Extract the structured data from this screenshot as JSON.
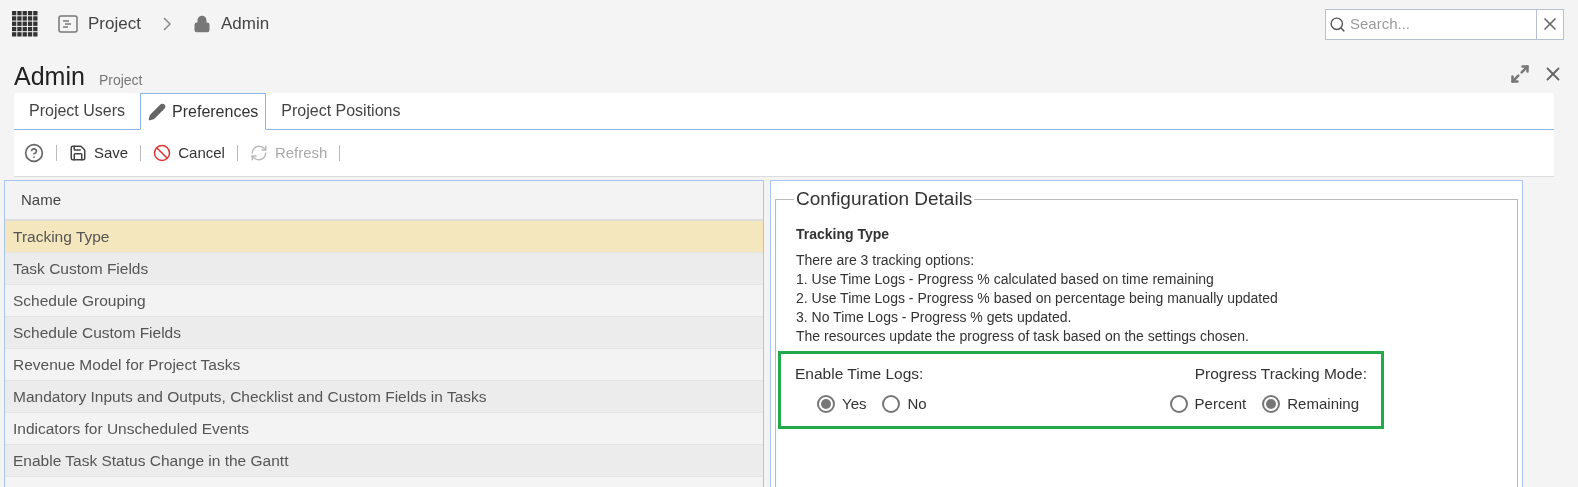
{
  "breadcrumb": [
    {
      "kind": "project",
      "label": "Project"
    },
    {
      "kind": "lock",
      "label": "Admin"
    }
  ],
  "search": {
    "placeholder": "Search..."
  },
  "page": {
    "title": "Admin",
    "subtitle": "Project"
  },
  "tabs": [
    {
      "label": "Project Users",
      "selected": false,
      "kind": "plain"
    },
    {
      "label": "Preferences",
      "selected": true,
      "kind": "pencil"
    },
    {
      "label": "Project Positions",
      "selected": false,
      "kind": "plain"
    }
  ],
  "toolbar": [
    {
      "kind": "help",
      "disabled": false
    },
    {
      "kind": "save",
      "label": "Save",
      "disabled": false
    },
    {
      "kind": "cancel",
      "label": "Cancel",
      "disabled": false
    },
    {
      "kind": "refresh",
      "label": "Refresh",
      "disabled": true
    }
  ],
  "table": {
    "columns": [
      "Name"
    ],
    "rows": [
      {
        "name": "Tracking Type",
        "selected": true
      },
      {
        "name": "Task Custom Fields",
        "selected": false
      },
      {
        "name": "Schedule Grouping",
        "selected": false
      },
      {
        "name": "Schedule Custom Fields",
        "selected": false
      },
      {
        "name": "Revenue Model for Project Tasks",
        "selected": false
      },
      {
        "name": "Mandatory Inputs and Outputs, Checklist and Custom Fields in Tasks",
        "selected": false
      },
      {
        "name": "Indicators for Unscheduled Events",
        "selected": false
      },
      {
        "name": "Enable Task Status Change in the Gantt",
        "selected": false
      }
    ]
  },
  "details": {
    "legend": "Configuration Details",
    "heading": "Tracking Type",
    "lines": [
      "There are 3 tracking options:",
      "1. Use Time Logs - Progress % calculated based on time remaining",
      "2. Use Time Logs - Progress % based on percentage being manually updated",
      "3. No Time Logs - Progress % gets updated.",
      "The resources update the progress of task based on the settings chosen."
    ],
    "groups": [
      {
        "label": "Enable Time Logs:",
        "options": [
          {
            "label": "Yes",
            "selected": true
          },
          {
            "label": "No",
            "selected": false
          }
        ]
      },
      {
        "label": "Progress Tracking Mode:",
        "options": [
          {
            "label": "Percent",
            "selected": false
          },
          {
            "label": "Remaining",
            "selected": true
          }
        ]
      }
    ]
  }
}
